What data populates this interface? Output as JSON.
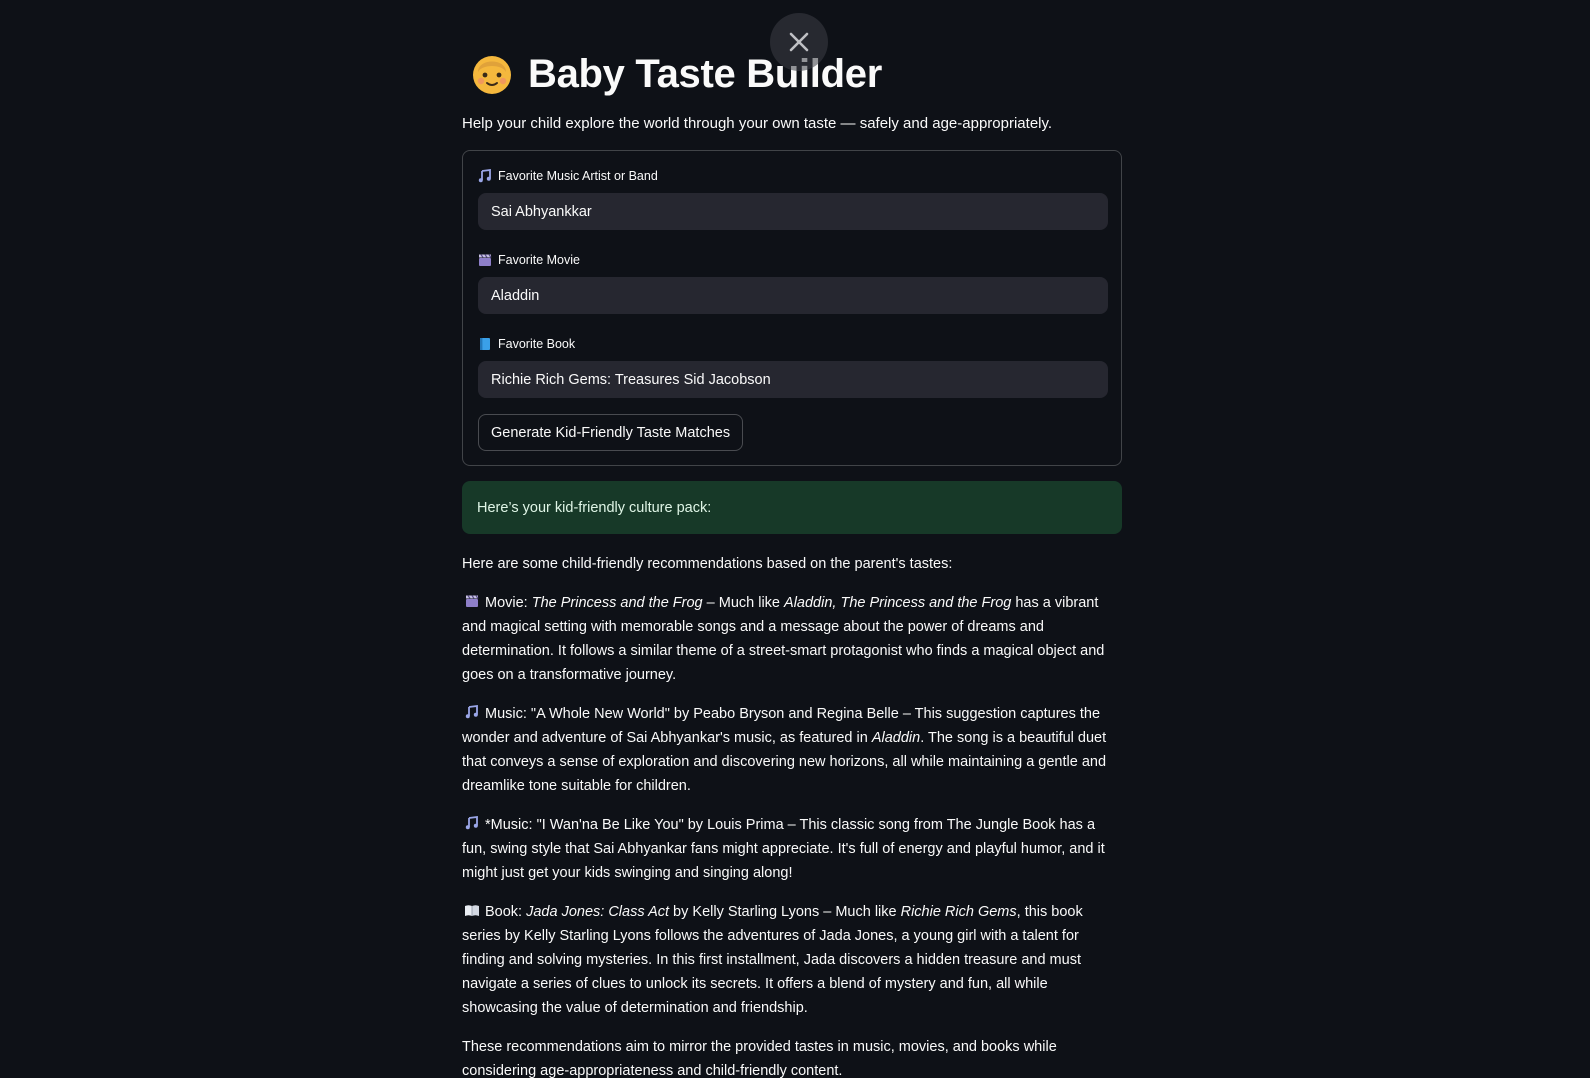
{
  "app": {
    "title": "Baby Taste Builder",
    "subtitle": "Help your child explore the world through your own taste — safely and age-appropriately."
  },
  "form": {
    "music": {
      "label": "Favorite Music Artist or Band",
      "value": "Sai Abhyankkar",
      "icon": "music-note-icon"
    },
    "movie": {
      "label": "Favorite Movie",
      "value": "Aladdin",
      "icon": "clapperboard-icon"
    },
    "book": {
      "label": "Favorite Book",
      "value": "Richie Rich Gems: Treasures Sid Jacobson",
      "icon": "blue-book-icon"
    },
    "submit_label": "Generate Kid-Friendly Taste Matches"
  },
  "success_message": "Here’s your kid-friendly culture pack:",
  "results": {
    "intro": "Here are some child-friendly recommendations based on the parent's tastes:",
    "movie": {
      "prefix": "Movie: ",
      "title": "The Princess and the Frog",
      "sep": " – Much like ",
      "ref": "Aladdin, The Princess and the Frog",
      "body": " has a vibrant and magical setting with memorable songs and a message about the power of dreams and determination. It follows a similar theme of a street-smart protagonist who finds a magical object and goes on a transformative journey."
    },
    "music1": {
      "text_a": "Music: \"A Whole New World\" by Peabo Bryson and Regina Belle – This suggestion captures the wonder and adventure of Sai Abhyankar's music, as featured in ",
      "ref": "Aladdin",
      "text_b": ". The song is a beautiful duet that conveys a sense of exploration and discovering new horizons, all while maintaining a gentle and dreamlike tone suitable for children."
    },
    "music2": {
      "text": "*Music: \"I Wan'na Be Like You\" by Louis Prima – This classic song from The Jungle Book has a fun, swing style that Sai Abhyankar fans might appreciate. It's full of energy and playful humor, and it might just get your kids swinging and singing along!"
    },
    "book": {
      "prefix": "Book: ",
      "title": "Jada Jones: Class Act",
      "mid": " by Kelly Starling Lyons – Much like ",
      "ref": "Richie Rich Gems",
      "body": ", this book series by Kelly Starling Lyons follows the adventures of Jada Jones, a young girl with a talent for finding and solving mysteries. In this first installment, Jada discovers a hidden treasure and must navigate a series of clues to unlock its secrets. It offers a blend of mystery and fun, all while showcasing the value of determination and friendship."
    },
    "closing": "These recommendations aim to mirror the provided tastes in music, movies, and books while considering age-appropriateness and child-friendly content."
  },
  "colors": {
    "background": "#0e1117",
    "input_bg": "#262730",
    "success_bg": "#173928"
  }
}
